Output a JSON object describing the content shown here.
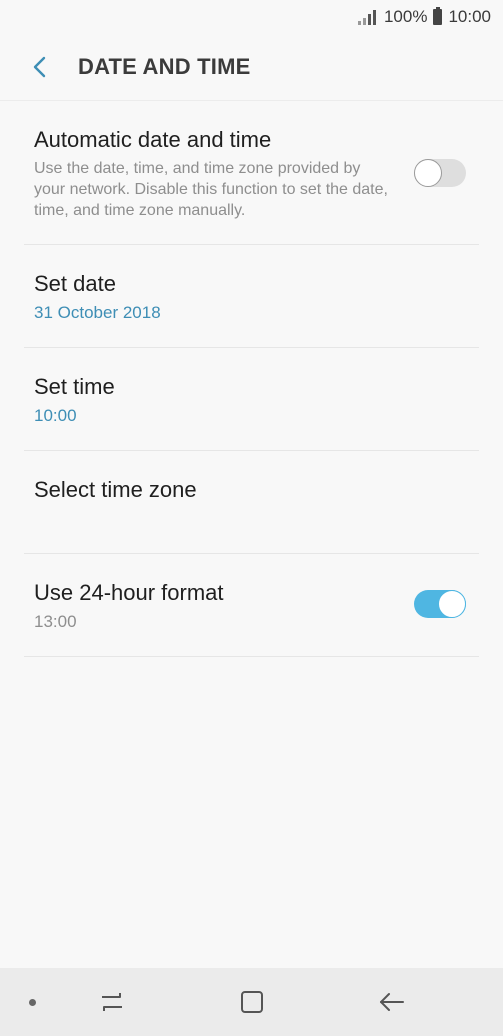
{
  "status_bar": {
    "battery_percent": "100%",
    "time": "10:00"
  },
  "header": {
    "title": "DATE AND TIME",
    "back_icon": "chevron-left-icon"
  },
  "settings": [
    {
      "title": "Automatic date and time",
      "description": "Use the date, time, and time zone provided by your network. Disable this function to set the date, time, and time zone manually.",
      "toggle": false
    },
    {
      "title": "Set date",
      "value": "31 October 2018"
    },
    {
      "title": "Set time",
      "value": "10:00"
    },
    {
      "title": "Select time zone"
    },
    {
      "title": "Use 24-hour format",
      "value": "13:00",
      "toggle": true
    }
  ],
  "nav_bar": {
    "icons": [
      "dot-icon",
      "recent-apps-icon",
      "home-icon",
      "back-arrow-icon"
    ]
  },
  "colors": {
    "accent": "#3e8eb5",
    "toggle_on": "#4fb6e2",
    "background": "#f8f8f8"
  }
}
